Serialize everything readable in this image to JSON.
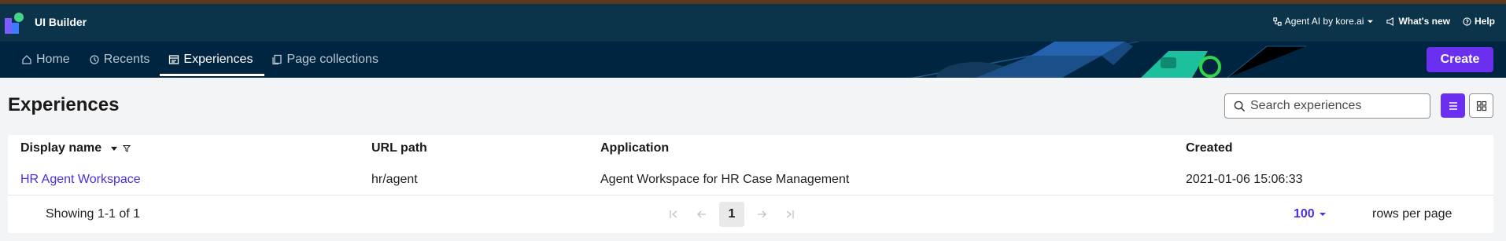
{
  "app": {
    "title": "UI Builder"
  },
  "top_nav": {
    "agent_label": "Agent AI by kore.ai",
    "whats_new_label": "What's new",
    "help_label": "Help"
  },
  "tabs": [
    {
      "label": "Home",
      "icon": "home-icon",
      "active": false
    },
    {
      "label": "Recents",
      "icon": "history-icon",
      "active": false
    },
    {
      "label": "Experiences",
      "icon": "experiences-icon",
      "active": true
    },
    {
      "label": "Page collections",
      "icon": "pages-icon",
      "active": false
    }
  ],
  "create_label": "Create",
  "page": {
    "title": "Experiences"
  },
  "search": {
    "placeholder": "Search experiences"
  },
  "table": {
    "columns": [
      "Display name",
      "URL path",
      "Application",
      "Created"
    ],
    "rows": [
      {
        "display_name": "HR Agent Workspace",
        "url_path": "hr/agent",
        "application": "Agent Workspace for HR Case Management",
        "created": "2021-01-06 15:06:33"
      }
    ]
  },
  "pagination": {
    "showing": "Showing 1-1 of 1",
    "current_page": "1",
    "rows_per_page": "100",
    "rows_label": "rows per page"
  },
  "colors": {
    "topbar": "#0b3349",
    "navbar": "#002540",
    "accent": "#6b2ff0",
    "link": "#4b2ee0"
  }
}
